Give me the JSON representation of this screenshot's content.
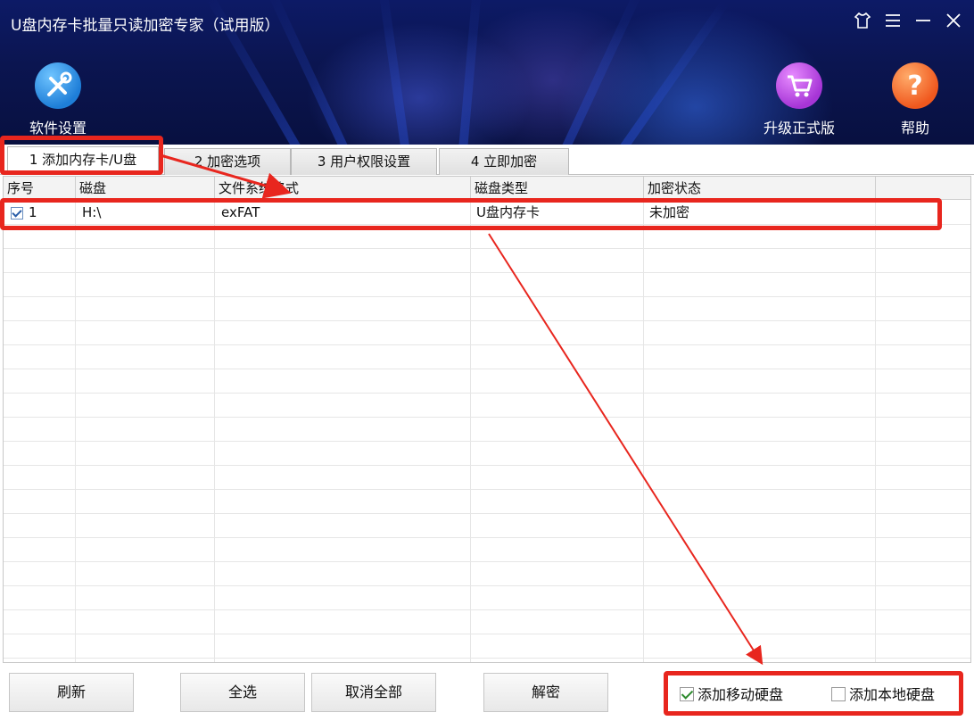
{
  "window": {
    "title": "U盘内存卡批量只读加密专家（试用版）",
    "controls": [
      "skin-icon",
      "menu-icon",
      "minimize-icon",
      "close-icon"
    ]
  },
  "header": {
    "settings_label": "软件设置",
    "upgrade_label": "升级正式版",
    "help_label": "帮助"
  },
  "tabs": [
    {
      "label": "1 添加内存卡/U盘",
      "active": true
    },
    {
      "label": "2 加密选项",
      "active": false
    },
    {
      "label": "3 用户权限设置",
      "active": false
    },
    {
      "label": "4 立即加密",
      "active": false
    }
  ],
  "table": {
    "columns": [
      "序号",
      "磁盘",
      "文件系统格式",
      "磁盘类型",
      "加密状态"
    ],
    "rows": [
      {
        "checked": true,
        "index": "1",
        "disk": "H:\\",
        "fs": "exFAT",
        "type": "U盘内存卡",
        "status": "未加密"
      }
    ]
  },
  "footer": {
    "refresh": "刷新",
    "select_all": "全选",
    "deselect_all": "取消全部",
    "decrypt": "解密",
    "opt_removable": {
      "label": "添加移动硬盘",
      "checked": true
    },
    "opt_local": {
      "label": "添加本地硬盘",
      "checked": false
    }
  },
  "colors": {
    "annotation": "#e8261e",
    "header_bg": "#0b1550"
  }
}
